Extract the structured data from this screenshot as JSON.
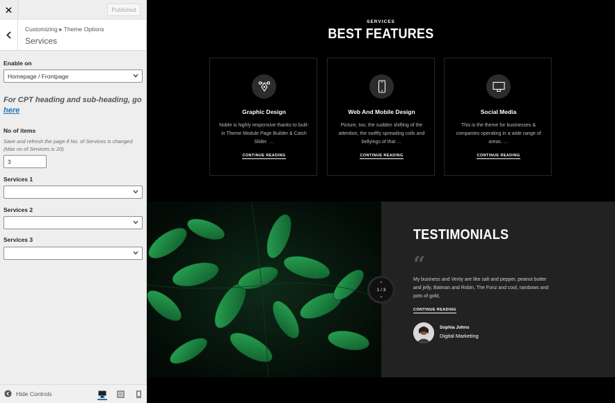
{
  "customizer": {
    "published_label": "Published",
    "breadcrumb_parent": "Customizing",
    "breadcrumb_sep": "▸",
    "breadcrumb_child": "Theme Options",
    "section_title": "Services",
    "enable_on": {
      "label": "Enable on",
      "value": "Homepage / Frontpage"
    },
    "cpt_note": "For CPT heading and sub-heading, go",
    "cpt_link": "here",
    "no_of_items": {
      "label": "No of items",
      "description": "Save and refresh the page if No. of Services is changed (Max no of Services is 20)",
      "value": "3"
    },
    "services": [
      {
        "label": "Services 1",
        "value": ""
      },
      {
        "label": "Services 2",
        "value": ""
      },
      {
        "label": "Services 3",
        "value": ""
      }
    ],
    "footer": {
      "hide_controls_label": "Hide Controls"
    }
  },
  "preview": {
    "services_kicker": "SERVICES",
    "services_title": "BEST FEATURES",
    "cards": [
      {
        "icon": "pen-tool-icon",
        "title": "Graphic Design",
        "text": "Noble is highly responsive thanks to built-in Theme Module Page Builder & Catch Slider. …",
        "link": "CONTINUE READING"
      },
      {
        "icon": "mobile-phone-icon",
        "title": "Web And Mobile Design",
        "text": "Picture, too, the sudden shifting of the attention, the swiftly spreading coils and bellyings of that …",
        "link": "CONTINUE READING"
      },
      {
        "icon": "monitor-icon",
        "title": "Social Media",
        "text": "This is the theme for businesses & companies operating in a wide range of areas. …",
        "link": "CONTINUE READING"
      }
    ],
    "testimonials": {
      "title": "TESTIMONIALS",
      "quote_mark": "“",
      "text": "My business and Verity are like salt and pepper, peanut butter and jelly, Batman and Robin, The Fonz and cool, rainbows and pots of gold,",
      "link": "CONTINUE READING",
      "author_name": "Sophia Johns",
      "author_role": "Digital Marketing",
      "slider_counter": "1 / 3"
    }
  },
  "colors": {
    "accent": "#2271b1",
    "leaf_green": "#1f8a45"
  }
}
